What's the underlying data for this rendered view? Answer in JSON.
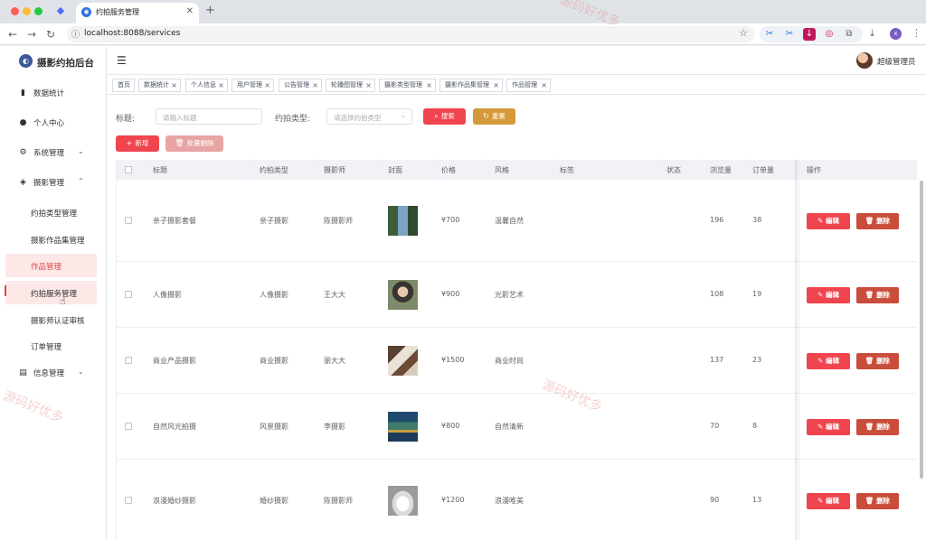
{
  "browser": {
    "tab_title": "约拍服务管理",
    "url": "localhost:8088/services",
    "profile_initial": "x"
  },
  "app": {
    "title": "摄影约拍后台"
  },
  "sidebar": {
    "items": [
      {
        "label": "数据统计",
        "icon": "bar-chart-icon"
      },
      {
        "label": "个人中心",
        "icon": "user-icon"
      },
      {
        "label": "系统管理",
        "icon": "gear-icon"
      },
      {
        "label": "摄影管理",
        "icon": "aperture-icon"
      }
    ],
    "photo_sub": [
      "约拍类型管理",
      "摄影作品集管理",
      "作品管理",
      "约拍服务管理",
      "摄影师认证审核",
      "订单管理"
    ],
    "info_label": "信息管理"
  },
  "header": {
    "user_name": "超级管理员"
  },
  "tags": [
    {
      "label": "首页",
      "closable": false
    },
    {
      "label": "数据统计",
      "closable": true
    },
    {
      "label": "个人信息",
      "closable": true
    },
    {
      "label": "用户管理",
      "closable": true
    },
    {
      "label": "公告管理",
      "closable": true
    },
    {
      "label": "轮播图管理",
      "closable": true
    },
    {
      "label": "摄影类型管理",
      "closable": true
    },
    {
      "label": "摄影作品集管理",
      "closable": true
    },
    {
      "label": "作品管理",
      "closable": true
    }
  ],
  "search": {
    "title_label": "标题:",
    "title_placeholder": "请输入标题",
    "type_label": "约拍类型:",
    "type_placeholder": "请选择约拍类型",
    "search_btn": "搜索",
    "reset_btn": "重置"
  },
  "actions": {
    "add_btn": "新增",
    "batch_delete_btn": "批量删除"
  },
  "table": {
    "columns": [
      "标题",
      "约拍类型",
      "摄影师",
      "封面",
      "价格",
      "风格",
      "标签",
      "状态",
      "浏览量",
      "订单量",
      "操作"
    ],
    "edit_label": "编辑",
    "delete_label": "删除",
    "rows": [
      {
        "title": "亲子摄影套餐",
        "type": "亲子摄影",
        "photographer": "陈摄影师",
        "price": "¥700",
        "style": "温馨自然",
        "views": "196",
        "orders": "38",
        "cover": "family-photo-grid"
      },
      {
        "title": "人像摄影",
        "type": "人像摄影",
        "photographer": "王大大",
        "price": "¥900",
        "style": "光影艺术",
        "views": "108",
        "orders": "19",
        "cover": "portrait-photo"
      },
      {
        "title": "商业产品摄影",
        "type": "商业摄影",
        "photographer": "丽大大",
        "price": "¥1500",
        "style": "商业时尚",
        "views": "137",
        "orders": "23",
        "cover": "product-photo"
      },
      {
        "title": "自然风光拍摄",
        "type": "风景摄影",
        "photographer": "李摄影",
        "price": "¥800",
        "style": "自然清新",
        "views": "70",
        "orders": "8",
        "cover": "landscape-photo"
      },
      {
        "title": "浪漫婚纱摄影",
        "type": "婚纱摄影",
        "photographer": "陈摄影师",
        "price": "¥1200",
        "style": "浪漫唯美",
        "views": "90",
        "orders": "13",
        "cover": "wedding-photo"
      }
    ]
  },
  "watermark": "源码好优多"
}
